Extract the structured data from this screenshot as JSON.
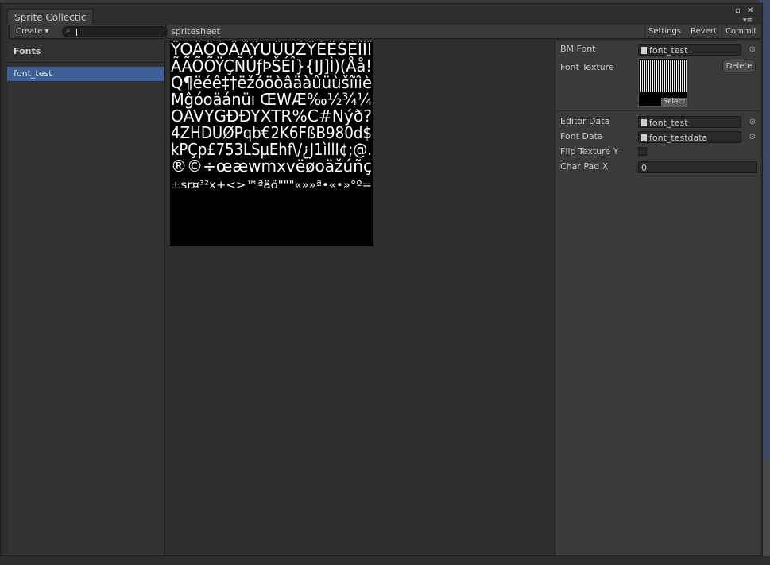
{
  "window": {
    "tab_title": "Sprite Collectic"
  },
  "icons": {
    "maximize": "▫",
    "close": "✕",
    "menu": "▾≡"
  },
  "toolbar": {
    "create_label": "Create ▾",
    "search_value": "",
    "search_icon": "search-icon",
    "section_title": "spritesheet",
    "settings_label": "Settings",
    "revert_label": "Revert",
    "commit_label": "Commit"
  },
  "fonts_list": {
    "header": "Fonts",
    "items": [
      {
        "label": "font_test",
        "selected": true
      }
    ]
  },
  "texture_glyph_rows": [
    "ŸÕÂÔÕÂÂŸÜÛÜŽŸÉËŠÈÏÌÎ",
    "ÃÃÕÕŸÇÑÚƒÞŠÉÎ}{Ĳ]Ì)(Åå!",
    "Q¶ëéê‡†ëžóöòâäàûüùšîïìè",
    "Mĝóoäánüı ŒWÆ‰½¾¼",
    "OAVYGĐÐYXTR%C#Nýð?",
    "4ZHDUØPqb€2K6FßB980d$",
    "kPÇp£753LSµEhf\\/¿J1ìllI¢;@.",
    "®©÷œæwmxvëøoäžúñç",
    "±sr¤³²x+<>™ªäö\"\"\"«»»ª•«•»°º="
  ],
  "properties": {
    "bm_font_label": "BM Font",
    "bm_font_value": "font_test",
    "font_texture_label": "Font Texture",
    "delete_label": "Delete",
    "select_label": "Select",
    "editor_data_label": "Editor Data",
    "editor_data_value": "font_test",
    "font_data_label": "Font Data",
    "font_data_value": "font_testdata",
    "flip_texture_label": "Flip Texture Y",
    "flip_texture_checked": false,
    "char_pad_label": "Char Pad X",
    "char_pad_value": "0"
  },
  "colors": {
    "selection": "#3e5f96",
    "panel_bg": "#3a3a3a",
    "texture_bg": "#000000",
    "glyph": "#ffffff"
  }
}
